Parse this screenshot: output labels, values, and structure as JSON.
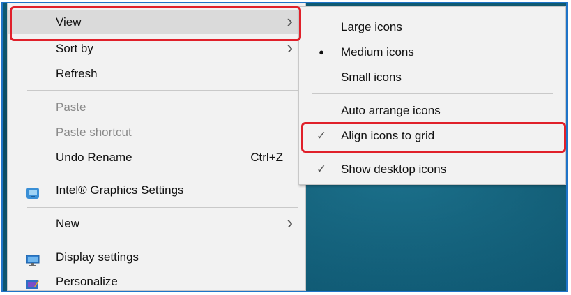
{
  "context_menu": {
    "items": [
      {
        "label": "View"
      },
      {
        "label": "Sort by"
      },
      {
        "label": "Refresh"
      },
      {
        "label": "Paste"
      },
      {
        "label": "Paste shortcut"
      },
      {
        "label": "Undo Rename",
        "shortcut": "Ctrl+Z"
      },
      {
        "label": "Intel® Graphics Settings"
      },
      {
        "label": "New"
      },
      {
        "label": "Display settings"
      },
      {
        "label": "Personalize"
      }
    ],
    "chevron": "›"
  },
  "view_submenu": {
    "items": [
      {
        "label": "Large icons"
      },
      {
        "label": "Medium icons",
        "mark": "●"
      },
      {
        "label": "Small icons"
      },
      {
        "label": "Auto arrange icons"
      },
      {
        "label": "Align icons to grid",
        "mark": "✓"
      },
      {
        "label": "Show desktop icons",
        "mark": "✓"
      }
    ]
  },
  "colors": {
    "frame": "#1f74c8",
    "highlight": "#e0202a",
    "menu_bg": "#f2f2f2",
    "hover_bg": "#dadada",
    "desktop": "#0f5a72"
  }
}
